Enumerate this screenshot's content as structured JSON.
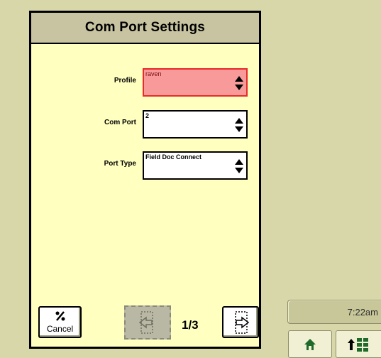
{
  "dialog": {
    "title": "Com Port Settings"
  },
  "fields": [
    {
      "label": "Profile",
      "value": "raven",
      "active": true
    },
    {
      "label": "Com Port",
      "value": "2",
      "active": false
    },
    {
      "label": "Port Type",
      "value": "Field Doc Connect",
      "active": false
    }
  ],
  "footer": {
    "cancel_label": "Cancel",
    "page_indicator": "1/3"
  },
  "status": {
    "time": "7:22am"
  },
  "colors": {
    "active_field_border": "#e82a2a",
    "active_field_fill": "#f99a9a",
    "dialog_body": "#ffffc0",
    "header_bar": "#c8c4a2",
    "desktop": "#d8d7aa"
  },
  "icons": {
    "cancel": "slash-cancel-icon",
    "prev": "page-back-icon",
    "next": "page-forward-icon",
    "home": "home-icon",
    "menu": "up-arrow-grid-icon",
    "spinner": "up-down-spinner-icon"
  }
}
